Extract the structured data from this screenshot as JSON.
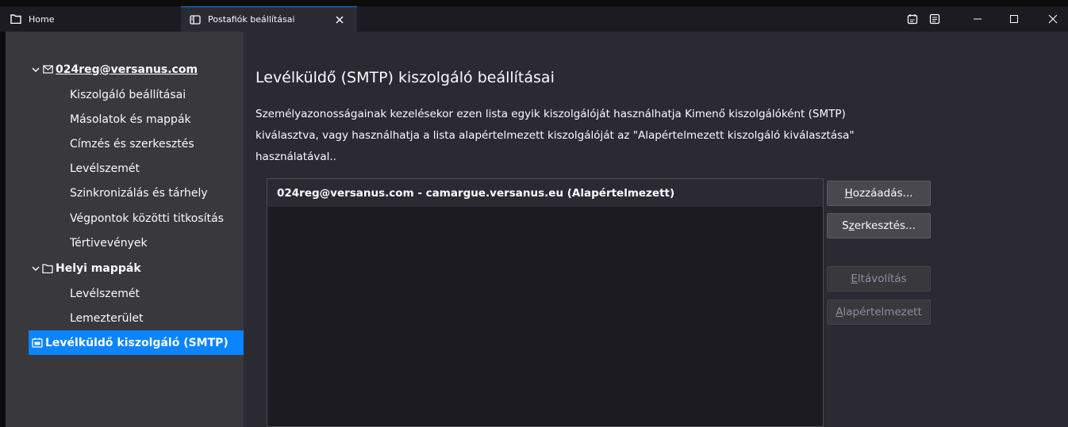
{
  "tabs": [
    {
      "label": "Home",
      "icon": "folder-icon"
    },
    {
      "label": "Postafiók beállításai",
      "icon": "account-settings-icon"
    }
  ],
  "window": {
    "icons": [
      "calendar-icon",
      "tasks-icon",
      "minimize-icon",
      "maximize-icon",
      "close-icon"
    ]
  },
  "sidebar": {
    "account": {
      "label": "024reg@versanus.com",
      "icon": "envelope-icon"
    },
    "account_items": [
      "Kiszolgáló beállításai",
      "Másolatok és mappák",
      "Címzés és szerkesztés",
      "Levélszemét",
      "Szinkronizálás és tárhely",
      "Végpontok közötti titkosítás",
      "Tértivevények"
    ],
    "local": {
      "label": "Helyi mappák",
      "icon": "folder-icon"
    },
    "local_items": [
      "Levélszemét",
      "Lemezterület"
    ],
    "smtp": {
      "label": "Levélküldő kiszolgáló (SMTP)",
      "icon": "outgoing-server-icon"
    }
  },
  "main": {
    "title": "Levélküldő (SMTP) kiszolgáló beállításai",
    "desc_lines": [
      "Személyazonosságainak kezelésekor ezen lista egyik kiszolgálóját használhatja Kimenő kiszolgálóként (SMTP)",
      "kiválasztva, vagy használhatja a lista alapértelmezett kiszolgálóját az \"Alapértelmezett kiszolgáló kiválasztása\"",
      "használatával.."
    ],
    "servers": [
      "024reg@versanus.com - camargue.versanus.eu (Alapértelmezett)"
    ],
    "buttons": {
      "add": {
        "accel": "H",
        "rest": "ozzáadás..."
      },
      "edit": {
        "pre": "S",
        "accel": "z",
        "rest": "erkesztés..."
      },
      "remove": {
        "accel": "E",
        "rest": "ltávolítás"
      },
      "default": {
        "accel": "A",
        "rest": "lapértelmezett"
      }
    }
  },
  "colors": {
    "accent": "#0a84ff",
    "sidebar_bg": "#38383d",
    "main_bg": "#2b2a33",
    "tab_bg": "#1c1b22"
  }
}
